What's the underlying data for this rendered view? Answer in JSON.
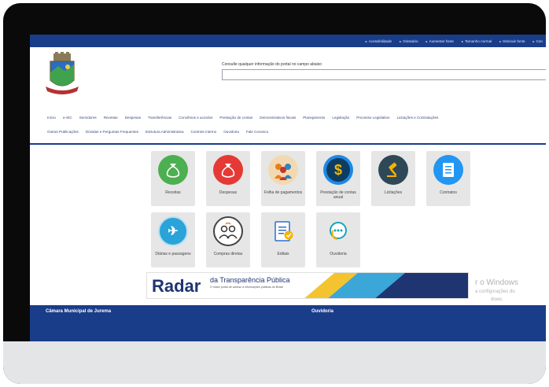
{
  "top_links": [
    "Acessibilidade",
    "Glossário",
    "Aumentar fonte",
    "Tamanho normal",
    "Diminuir fonte",
    "Con"
  ],
  "search": {
    "hint": "Consulte qualquer informação do portal no campo abaixo",
    "value": ""
  },
  "nav_row1": [
    "Início",
    "e-SIC",
    "Servidores",
    "Receitas",
    "Despesas",
    "Transferências",
    "Convênios e acordos",
    "Prestação de contas",
    "Demonstrativos fiscais",
    "Planejamento",
    "Legislação",
    "Processo Legislativo",
    "Licitações e Contratações"
  ],
  "nav_row2": [
    "Outras Publicações",
    "Dúvidas e Perguntas Frequentes",
    "Estrutura Administrativa",
    "Controle interno",
    "Ouvidoria",
    "Fale Conosco"
  ],
  "tiles": [
    {
      "label": "Receitas",
      "icon": "money-bag-icon",
      "color": "#4caf50"
    },
    {
      "label": "Despesas",
      "icon": "money-bag-icon",
      "color": "#e53935"
    },
    {
      "label": "Folha de pagamentos",
      "icon": "people-group-icon",
      "color": "#f39c12"
    },
    {
      "label": "Prestação de contas anual",
      "icon": "dollar-icon",
      "color": "#1e88e5"
    },
    {
      "label": "Licitações",
      "icon": "gavel-icon",
      "color": "#2f4858"
    },
    {
      "label": "Contratos",
      "icon": "document-icon",
      "color": "#2196f3"
    },
    {
      "label": "Diárias e passagens",
      "icon": "plane-icon",
      "color": "#29a3d8"
    },
    {
      "label": "Compras diretas",
      "icon": "users-exchange-icon",
      "color": "#ffffff"
    },
    {
      "label": "Editais",
      "icon": "edital-icon",
      "color": "#ffffff"
    },
    {
      "label": "Ouvidoria",
      "icon": "chat-icon",
      "color": "#ffffff"
    }
  ],
  "radar": {
    "word": "Radar",
    "title": "da Transparência Pública",
    "subtitle": "O maior portal de acesso a informações públicas do Brasil"
  },
  "watermark": {
    "line1": "r o Windows",
    "line2": "a configurações do",
    "line3": "dows."
  },
  "footer": {
    "left": "Câmara Municipal de Jurema",
    "right": "Ouvidoria"
  }
}
